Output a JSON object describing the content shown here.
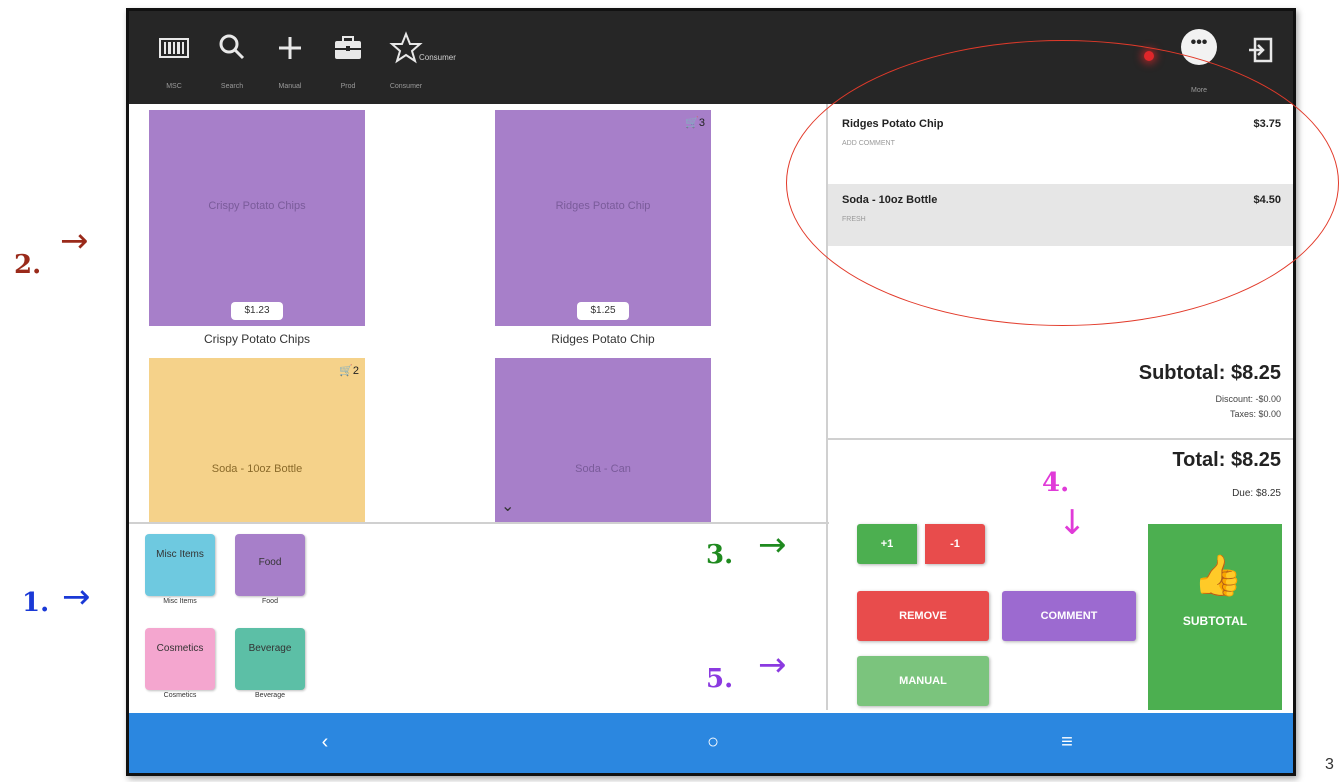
{
  "topbar": {
    "items": [
      {
        "icon": "barcode-icon",
        "label": "MSC"
      },
      {
        "icon": "search-icon",
        "label": "Search"
      },
      {
        "icon": "plus-icon",
        "label": "Manual"
      },
      {
        "icon": "briefcase-icon",
        "label": "Prod"
      },
      {
        "icon": "star-icon",
        "label": "Consumer"
      }
    ],
    "favorite_text": "Consumer",
    "more_label": "More"
  },
  "products": [
    {
      "name": "Crispy Potato Chips",
      "inner": "Crispy Potato Chips",
      "price": "$1.23",
      "color": "#a77fc9"
    },
    {
      "name": "Ridges Potato Chip",
      "inner": "Ridges Potato Chip",
      "price": "$1.25",
      "color": "#a77fc9",
      "cart": "3"
    },
    {
      "name": "",
      "inner": "Soda - 10oz Bottle",
      "price": "",
      "color": "#f5d28a",
      "cart": "2"
    },
    {
      "name": "",
      "inner": "Soda - Can",
      "price": "",
      "color": "#a77fc9"
    }
  ],
  "categories": [
    {
      "label": "Misc Items",
      "caption": "Misc Items",
      "color": "#6ec9e0"
    },
    {
      "label": "Food",
      "caption": "Food",
      "color": "#a77fc9"
    },
    {
      "label": "Cosmetics",
      "caption": "Cosmetics",
      "color": "#f4a6cf"
    },
    {
      "label": "Beverage",
      "caption": "Beverage",
      "color": "#5cbfa6"
    }
  ],
  "order": {
    "items": [
      {
        "name": "Ridges Potato Chip",
        "price": "$3.75",
        "note": "ADD COMMENT"
      },
      {
        "name": "Soda - 10oz Bottle",
        "price": "$4.50",
        "note": "FRESH"
      }
    ],
    "subtotal": "Subtotal: $8.25",
    "discount": "Discount: -$0.00",
    "taxes": "Taxes: $0.00",
    "total": "Total: $8.25",
    "due": "Due: $8.25"
  },
  "buttons": {
    "plus_one": "+1",
    "minus_one": "-1",
    "remove": "REMOVE",
    "comment": "COMMENT",
    "manual": "MANUAL",
    "subtotal": "SUBTOTAL"
  },
  "annotations": {
    "a1": "1.",
    "a2": "2.",
    "a3": "3.",
    "a4": "4.",
    "a5": "5.",
    "page": "3"
  },
  "colors": {
    "green": "#4caf50",
    "red": "#e84c4c",
    "purple": "#9c6ad0",
    "nav_blue": "#2b87e0"
  }
}
